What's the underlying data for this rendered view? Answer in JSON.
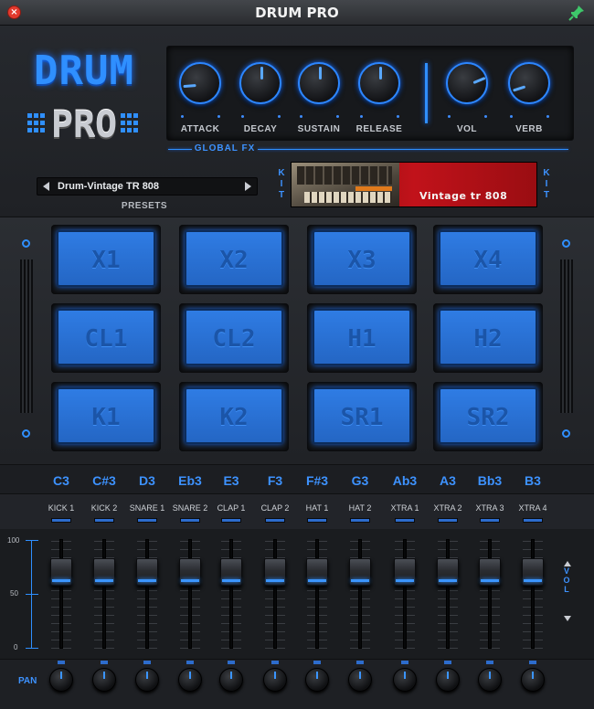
{
  "window": {
    "title": "DRUM PRO"
  },
  "logo": {
    "line1": "DRUM",
    "line2": "PRO"
  },
  "knobs": [
    {
      "label": "ATTACK",
      "value": 0.15
    },
    {
      "label": "DECAY",
      "value": 0.5
    },
    {
      "label": "SUSTAIN",
      "value": 0.5
    },
    {
      "label": "RELEASE",
      "value": 0.5
    },
    {
      "label": "VOL",
      "value": 0.75
    },
    {
      "label": "VERB",
      "value": 0.1
    }
  ],
  "global_fx": "GLOBAL FX",
  "presets": {
    "label": "PRESETS",
    "current": "Drum-Vintage TR 808"
  },
  "kit": {
    "side_label": "KIT",
    "name": "Vintage tr 808"
  },
  "pads": [
    "X1",
    "X2",
    "X3",
    "X4",
    "CL1",
    "CL2",
    "H1",
    "H2",
    "K1",
    "K2",
    "SR1",
    "SR2"
  ],
  "notes": [
    "C3",
    "C#3",
    "D3",
    "Eb3",
    "E3",
    "F3",
    "F#3",
    "G3",
    "Ab3",
    "A3",
    "Bb3",
    "B3"
  ],
  "tracks": [
    "KICK 1",
    "KICK 2",
    "SNARE 1",
    "SNARE 2",
    "CLAP 1",
    "CLAP 2",
    "HAT 1",
    "HAT 2",
    "XTRA 1",
    "XTRA 2",
    "XTRA 3",
    "XTRA 4"
  ],
  "mixer": {
    "scale": [
      "100",
      "50",
      "0"
    ],
    "vol_label": "VOL",
    "fader_levels": [
      0.7,
      0.7,
      0.7,
      0.7,
      0.7,
      0.7,
      0.7,
      0.7,
      0.7,
      0.7,
      0.7,
      0.7
    ]
  },
  "pan": {
    "label": "PAN",
    "values": [
      0.5,
      0.5,
      0.5,
      0.5,
      0.5,
      0.5,
      0.5,
      0.5,
      0.5,
      0.5,
      0.5,
      0.5
    ]
  },
  "colors": {
    "accent": "#2f8fff",
    "pad": "#2b72d6",
    "close": "#e23a2e",
    "kit_bg": "#c1121a"
  }
}
